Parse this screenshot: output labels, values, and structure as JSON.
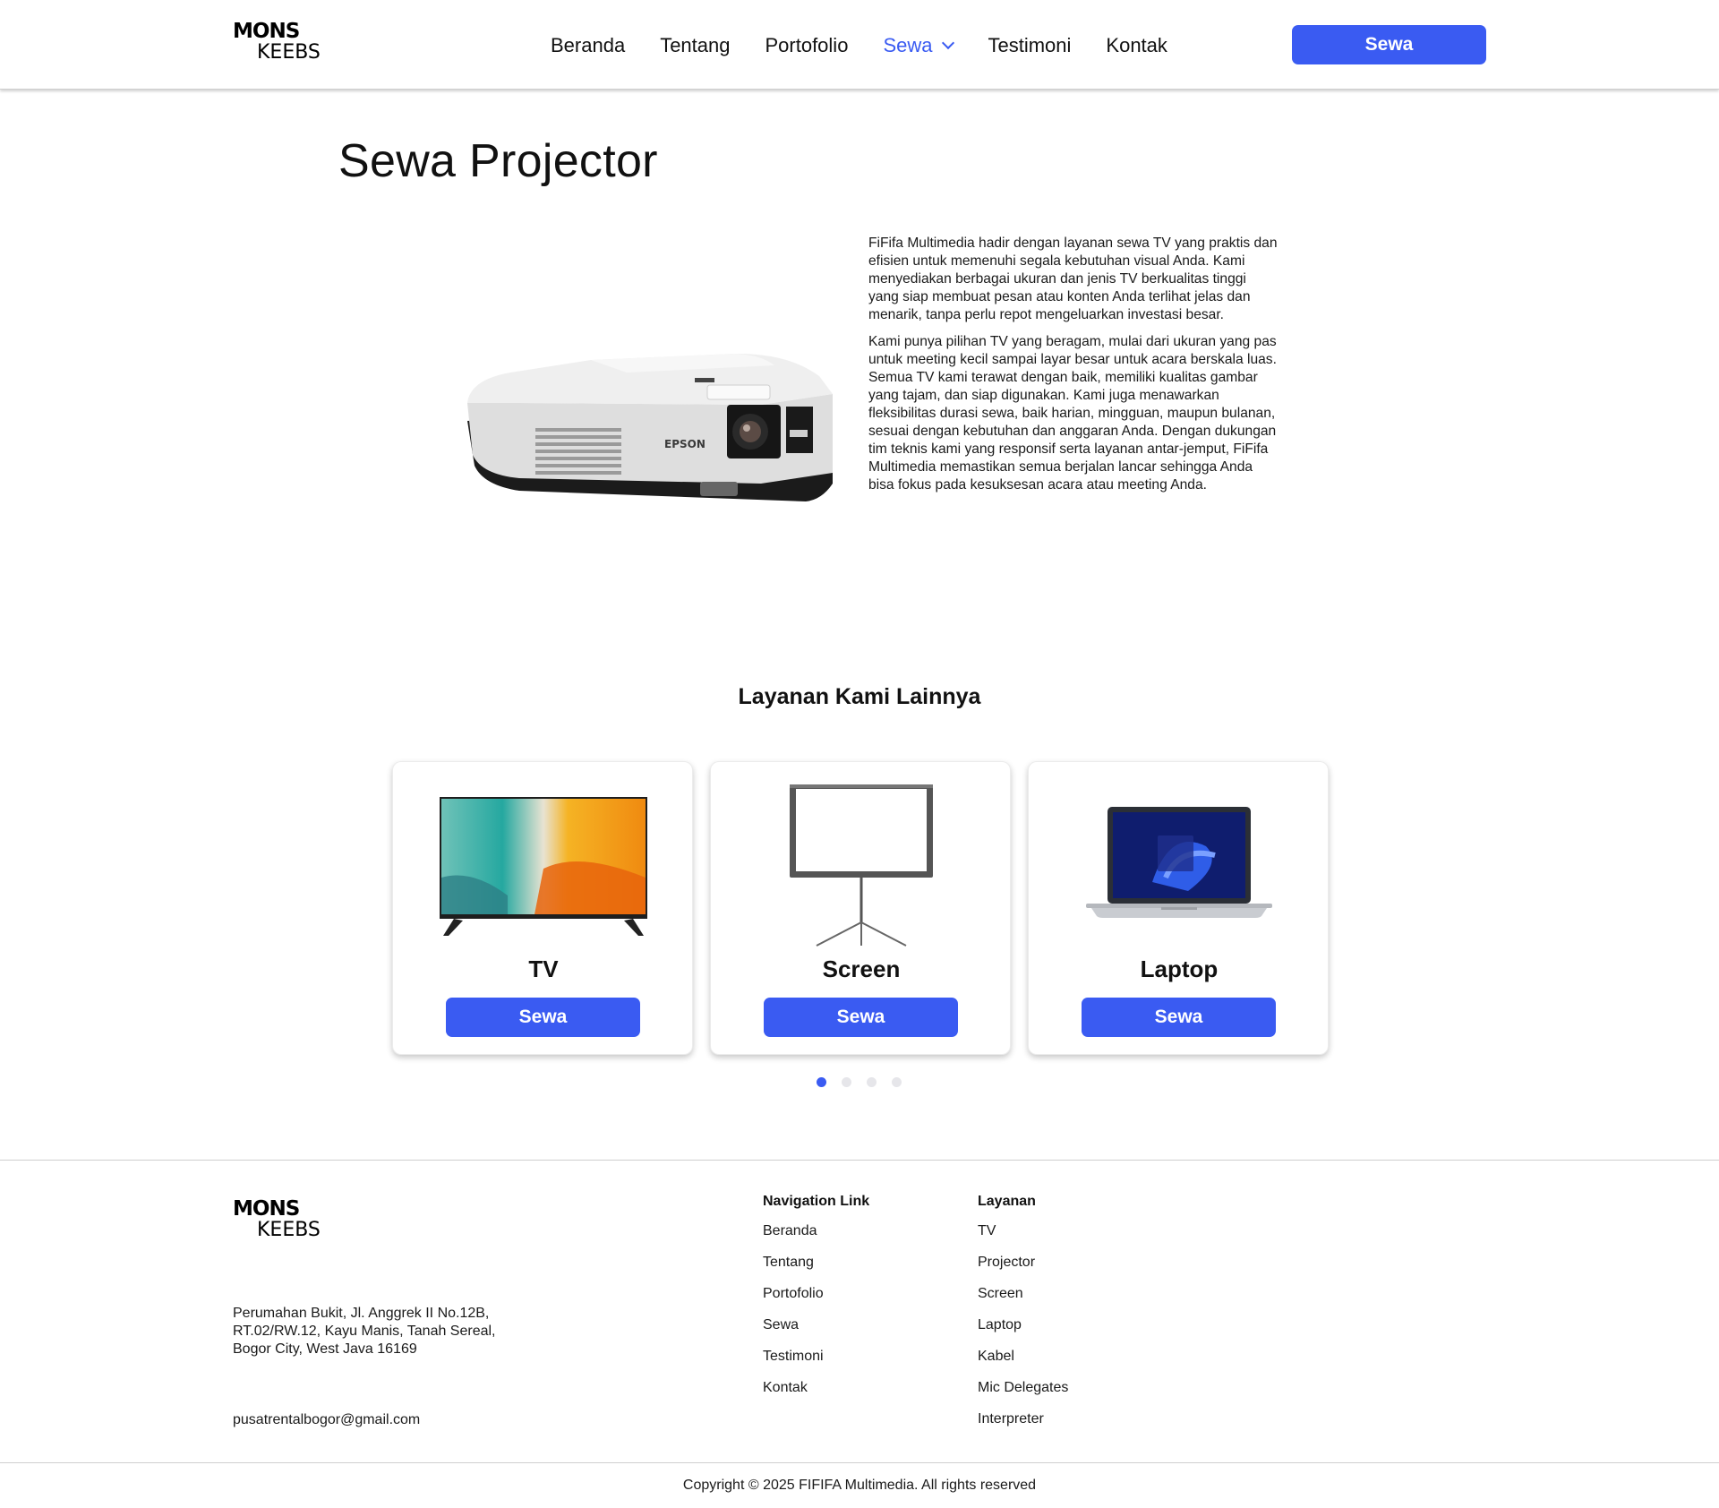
{
  "header": {
    "logo_line1": "MONS",
    "logo_line2": "KEEBS",
    "nav": [
      {
        "label": "Beranda"
      },
      {
        "label": "Tentang"
      },
      {
        "label": "Portofolio"
      },
      {
        "label": "Sewa"
      },
      {
        "label": "Testimoni"
      },
      {
        "label": "Kontak"
      }
    ],
    "active_nav": "Sewa",
    "cta_label": "Sewa"
  },
  "hero": {
    "title": "Sewa Projector",
    "image_icon": "epson-projector-image",
    "projector_brand": "EPSON",
    "paragraphs": [
      "FiFifa Multimedia hadir dengan layanan sewa TV yang praktis dan efisien untuk memenuhi segala kebutuhan visual Anda. Kami menyediakan berbagai ukuran dan jenis TV berkualitas tinggi yang siap membuat pesan atau konten Anda terlihat jelas dan menarik, tanpa perlu repot mengeluarkan investasi besar.",
      "Kami punya pilihan TV yang beragam, mulai dari ukuran yang pas untuk meeting kecil sampai layar besar untuk acara berskala luas. Semua TV kami terawat dengan baik, memiliki kualitas gambar yang tajam, dan siap digunakan. Kami juga menawarkan fleksibilitas durasi sewa, baik harian, mingguan, maupun bulanan, sesuai dengan kebutuhan dan anggaran Anda. Dengan dukungan tim teknis kami yang responsif serta layanan antar-jemput, FiFifa Multimedia memastikan semua berjalan lancar sehingga Anda bisa fokus pada kesuksesan acara atau meeting Anda."
    ]
  },
  "services": {
    "title": "Layanan Kami Lainnya",
    "cards": [
      {
        "name": "TV",
        "button": "Sewa",
        "icon": "tv-image"
      },
      {
        "name": "Screen",
        "button": "Sewa",
        "icon": "projector-screen-image"
      },
      {
        "name": "Laptop",
        "button": "Sewa",
        "icon": "laptop-image"
      }
    ],
    "pagination": {
      "pages": 4,
      "active": 1
    }
  },
  "footer": {
    "logo_line1": "MONS",
    "logo_line2": "KEEBS",
    "address": "Perumahan Bukit, Jl. Anggrek II No.12B, RT.02/RW.12, Kayu Manis, Tanah Sereal, Bogor City, West Java 16169",
    "email": "pusatrentalbogor@gmail.com",
    "nav_heading": "Navigation Link",
    "nav_links": [
      "Beranda",
      "Tentang",
      "Portofolio",
      "Sewa",
      "Testimoni",
      "Kontak"
    ],
    "services_heading": "Layanan",
    "services_links": [
      "TV",
      "Projector",
      "Screen",
      "Laptop",
      "Kabel",
      "Mic Delegates",
      "Interpreter"
    ],
    "copyright": "Copyright © 2025 FIFIFA Multimedia. All rights reserved"
  },
  "colors": {
    "accent": "#3a5bf2",
    "text": "#111111",
    "divider": "#cfcfcf",
    "dot_inactive": "#e6e6ea"
  }
}
